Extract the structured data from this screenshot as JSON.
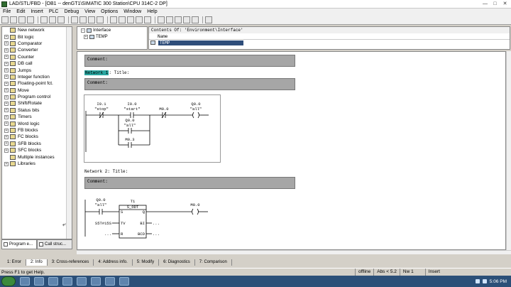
{
  "window": {
    "title": "LAD/STL/FBD - [OB1 -- denGT1\\SIMATIC 300 Station\\CPU 314C-2 DP]",
    "minimize": "—",
    "maximize": "□",
    "close": "✕"
  },
  "menu": [
    "File",
    "Edit",
    "Insert",
    "PLC",
    "Debug",
    "View",
    "Options",
    "Window",
    "Help"
  ],
  "toolbar": {
    "buttons": [
      "new",
      "open",
      "save",
      "print",
      "cut",
      "copy",
      "paste",
      "download",
      "undo",
      "redo",
      "monitor",
      "tiles",
      "ladder",
      "stl",
      "fbd",
      "overview",
      "insert-network",
      "contact",
      "coil",
      "branch-open",
      "branch-close",
      "help"
    ],
    "zoom_value": ""
  },
  "catalog": {
    "items": [
      {
        "label": "New network",
        "expandable": false
      },
      {
        "label": "Bit logic",
        "expandable": true
      },
      {
        "label": "Comparator",
        "expandable": true
      },
      {
        "label": "Converter",
        "expandable": true
      },
      {
        "label": "Counter",
        "expandable": true
      },
      {
        "label": "DB call",
        "expandable": true
      },
      {
        "label": "Jumps",
        "expandable": true
      },
      {
        "label": "Integer function",
        "expandable": true
      },
      {
        "label": "Floating-point fct.",
        "expandable": true
      },
      {
        "label": "Move",
        "expandable": true
      },
      {
        "label": "Program control",
        "expandable": true
      },
      {
        "label": "Shift/Rotate",
        "expandable": true
      },
      {
        "label": "Status bits",
        "expandable": true
      },
      {
        "label": "Timers",
        "expandable": true
      },
      {
        "label": "Word logic",
        "expandable": true
      },
      {
        "label": "FB blocks",
        "expandable": true
      },
      {
        "label": "FC blocks",
        "expandable": true
      },
      {
        "label": "SFB blocks",
        "expandable": true
      },
      {
        "label": "SFC blocks",
        "expandable": true
      },
      {
        "label": "Multiple instances",
        "expandable": false
      },
      {
        "label": "Libraries",
        "expandable": true
      }
    ],
    "tabs": [
      "Program e...",
      "Call struc..."
    ]
  },
  "interface": {
    "root_label": "Interface",
    "child_label": "TEMP"
  },
  "contents": {
    "title": "Contents Of: 'Environment\\Interface'",
    "col_name": "Name",
    "row_value": "TEMP"
  },
  "editor": {
    "block_comment": "Comment:",
    "network1": {
      "label": "Network 1",
      "suffix": ": Title:",
      "comment": "Comment:",
      "contacts": [
        {
          "address": "I0.1",
          "symbol": "\"stop\"",
          "type": "NC"
        },
        {
          "address": "I0.0",
          "symbol": "\"start\"",
          "type": "NO"
        },
        {
          "address": "M0.0",
          "symbol": "",
          "type": "NC"
        }
      ],
      "coil": {
        "address": "Q0.0",
        "symbol": "\"all\""
      },
      "branch": [
        {
          "address": "Q0.0",
          "symbol": "\"all\""
        },
        {
          "address": "M0.3",
          "symbol": ""
        }
      ]
    },
    "network2": {
      "label": "Network 2",
      "suffix": ": Title:",
      "comment": "Comment:",
      "contact": {
        "address": "Q0.0",
        "symbol": "\"all\""
      },
      "timer": {
        "name": "T1",
        "type": "S_ODT",
        "pins_left": [
          "S",
          "TV",
          "R"
        ],
        "pins_right": [
          "Q",
          "BI",
          "BCD"
        ],
        "tv_value": "S5T#15S",
        "r_value": "...",
        "bi_value": "...",
        "bcd_value": "..."
      },
      "coil": {
        "address": "M0.0",
        "symbol": ""
      }
    }
  },
  "bottom_tabs": [
    "1: Error",
    "2: Info",
    "3: Cross-references",
    "4: Address info.",
    "5: Modify",
    "6: Diagnostics",
    "7: Comparison"
  ],
  "status": {
    "help": "Press F1 to get Help.",
    "mode": "offline",
    "abs": "Abs < 5.2",
    "nw": "Nw 1",
    "insert": "Insert"
  },
  "taskbar": {
    "time": "5:06 PM",
    "apps": [
      "ie",
      "explorer",
      "media",
      "chrome",
      "tool1",
      "tool2",
      "tool3",
      "simatic"
    ]
  }
}
